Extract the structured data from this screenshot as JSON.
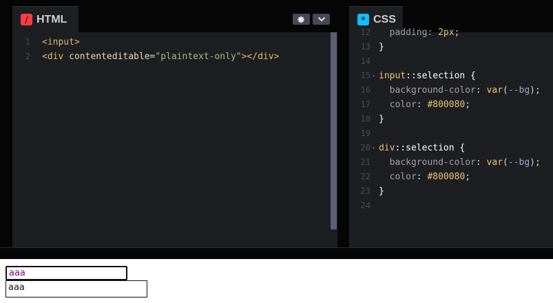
{
  "html_panel": {
    "tab_label": "HTML",
    "badge_glyph": "/",
    "lines": [
      {
        "n": "1",
        "parts": [
          {
            "c": "t-tag",
            "t": "<input>"
          }
        ]
      },
      {
        "n": "2",
        "parts": [
          {
            "c": "t-tag",
            "t": "<div "
          },
          {
            "c": "t-attr",
            "t": "contenteditable"
          },
          {
            "c": "t-punct",
            "t": "="
          },
          {
            "c": "t-str",
            "t": "\"plaintext-only\""
          },
          {
            "c": "t-tag",
            "t": "></div>"
          }
        ]
      }
    ]
  },
  "css_panel": {
    "tab_label": "CSS",
    "badge_glyph": "*",
    "lines": [
      {
        "n": "12",
        "fold": false,
        "parts": [
          {
            "c": "t-prop",
            "t": "  padding: "
          },
          {
            "c": "t-hex",
            "t": "2px"
          },
          {
            "c": "t-punct",
            "t": ";"
          }
        ]
      },
      {
        "n": "13",
        "fold": false,
        "parts": [
          {
            "c": "t-brace",
            "t": "}"
          }
        ]
      },
      {
        "n": "14",
        "fold": false,
        "parts": []
      },
      {
        "n": "15",
        "fold": true,
        "parts": [
          {
            "c": "t-sel",
            "t": "input"
          },
          {
            "c": "t-pseudo",
            "t": "::selection"
          },
          {
            "c": "t-brace",
            "t": " {"
          }
        ]
      },
      {
        "n": "16",
        "fold": false,
        "parts": [
          {
            "c": "t-prop",
            "t": "  background-color"
          },
          {
            "c": "t-punct",
            "t": ": "
          },
          {
            "c": "t-fn",
            "t": "var"
          },
          {
            "c": "t-punct",
            "t": "("
          },
          {
            "c": "t-var",
            "t": "--bg"
          },
          {
            "c": "t-punct",
            "t": ");"
          }
        ]
      },
      {
        "n": "17",
        "fold": false,
        "parts": [
          {
            "c": "t-prop",
            "t": "  color"
          },
          {
            "c": "t-punct",
            "t": ": "
          },
          {
            "c": "t-hex",
            "t": "#800080"
          },
          {
            "c": "t-punct",
            "t": ";"
          }
        ]
      },
      {
        "n": "18",
        "fold": false,
        "parts": [
          {
            "c": "t-brace",
            "t": "}"
          }
        ]
      },
      {
        "n": "19",
        "fold": false,
        "parts": []
      },
      {
        "n": "20",
        "fold": true,
        "parts": [
          {
            "c": "t-sel",
            "t": "div"
          },
          {
            "c": "t-pseudo",
            "t": "::selection"
          },
          {
            "c": "t-brace",
            "t": " {"
          }
        ]
      },
      {
        "n": "21",
        "fold": false,
        "parts": [
          {
            "c": "t-prop",
            "t": "  background-color"
          },
          {
            "c": "t-punct",
            "t": ": "
          },
          {
            "c": "t-fn",
            "t": "var"
          },
          {
            "c": "t-punct",
            "t": "("
          },
          {
            "c": "t-var",
            "t": "--bg"
          },
          {
            "c": "t-punct",
            "t": ");"
          }
        ]
      },
      {
        "n": "22",
        "fold": false,
        "parts": [
          {
            "c": "t-prop",
            "t": "  color"
          },
          {
            "c": "t-punct",
            "t": ": "
          },
          {
            "c": "t-hex",
            "t": "#800080"
          },
          {
            "c": "t-punct",
            "t": ";"
          }
        ]
      },
      {
        "n": "23",
        "fold": false,
        "parts": [
          {
            "c": "t-brace",
            "t": "}"
          }
        ]
      },
      {
        "n": "24",
        "fold": false,
        "parts": []
      }
    ]
  },
  "preview": {
    "input_value": "aaa",
    "div_text": "aaa"
  },
  "colors": {
    "editor_bg": "#1d1e22",
    "html_badge": "#ff3c41",
    "css_badge": "#0ebeff",
    "selection_color": "#800080"
  }
}
